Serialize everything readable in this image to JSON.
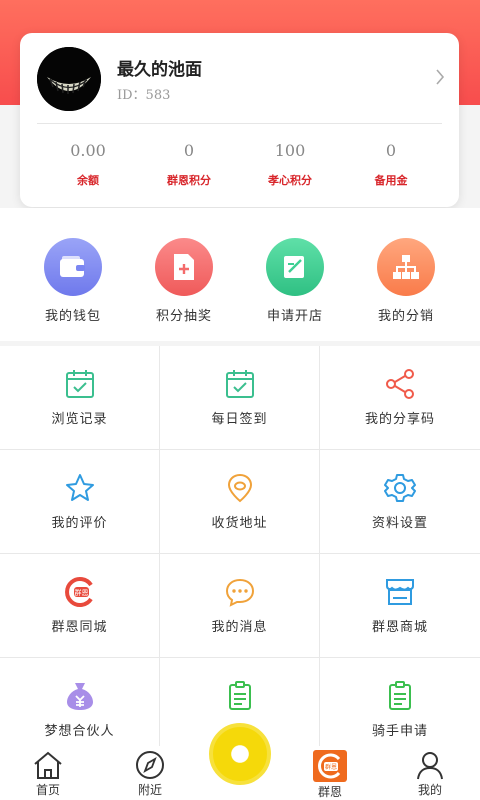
{
  "profile": {
    "name": "最久的池面",
    "id_text": "ID：583",
    "stats": [
      {
        "value": "0.00",
        "label": "余额"
      },
      {
        "value": "0",
        "label": "群恩积分"
      },
      {
        "value": "100",
        "label": "孝心积分"
      },
      {
        "value": "0",
        "label": "备用金"
      }
    ]
  },
  "quick_actions": [
    {
      "label": "我的钱包",
      "icon": "wallet-icon",
      "color": "#7b86f2"
    },
    {
      "label": "积分抽奖",
      "icon": "lottery-icon",
      "color": "#f46b6b"
    },
    {
      "label": "申请开店",
      "icon": "edit-icon",
      "color": "#3ecf93"
    },
    {
      "label": "我的分销",
      "icon": "distribution-icon",
      "color": "#fb8c5e"
    }
  ],
  "grid": [
    {
      "label": "浏览记录",
      "icon": "calendar-check-icon"
    },
    {
      "label": "每日签到",
      "icon": "calendar-check-icon"
    },
    {
      "label": "我的分享码",
      "icon": "share-icon"
    },
    {
      "label": "我的评价",
      "icon": "star-icon"
    },
    {
      "label": "收货地址",
      "icon": "location-icon"
    },
    {
      "label": "资料设置",
      "icon": "gear-icon"
    },
    {
      "label": "群恩同城",
      "icon": "qunen-logo-icon"
    },
    {
      "label": "我的消息",
      "icon": "message-icon"
    },
    {
      "label": "群恩商城",
      "icon": "store-icon"
    },
    {
      "label": "梦想合伙人",
      "icon": "money-bag-icon"
    },
    {
      "label": "",
      "icon": "document-icon"
    },
    {
      "label": "骑手申请",
      "icon": "document-icon"
    }
  ],
  "tabbar": [
    {
      "label": "首页",
      "icon": "home-icon"
    },
    {
      "label": "附近",
      "icon": "compass-icon"
    },
    {
      "label": "群恩",
      "icon": "qunen-tab-icon"
    },
    {
      "label": "我的",
      "icon": "user-icon"
    }
  ],
  "logo_text": "群恩"
}
